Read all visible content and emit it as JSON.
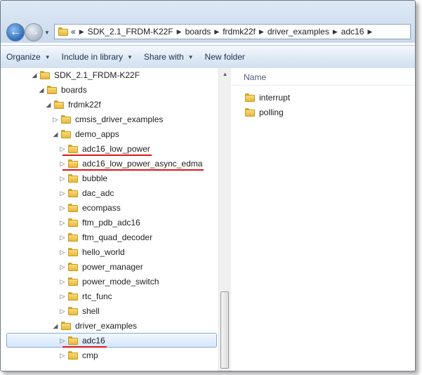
{
  "address": {
    "overflow": "«",
    "crumbs": [
      "SDK_2.1_FRDM-K22F",
      "boards",
      "frdmk22f",
      "driver_examples",
      "adc16"
    ],
    "separator": "▶"
  },
  "toolbar": {
    "organize": "Organize",
    "include_in_library": "Include in library",
    "share_with": "Share with",
    "new_folder": "New folder"
  },
  "tree": [
    {
      "label": "SDK_2.1_FRDM-K22F",
      "level": 0,
      "expander": "◢",
      "selected": false,
      "underlined": false
    },
    {
      "label": "boards",
      "level": 1,
      "expander": "◢",
      "selected": false,
      "underlined": false
    },
    {
      "label": "frdmk22f",
      "level": 2,
      "expander": "◢",
      "selected": false,
      "underlined": false
    },
    {
      "label": "cmsis_driver_examples",
      "level": 3,
      "expander": "▷",
      "selected": false,
      "underlined": false
    },
    {
      "label": "demo_apps",
      "level": 3,
      "expander": "◢",
      "selected": false,
      "underlined": false
    },
    {
      "label": "adc16_low_power",
      "level": 4,
      "expander": "▷",
      "selected": false,
      "underlined": true
    },
    {
      "label": "adc16_low_power_async_edma",
      "level": 4,
      "expander": "▷",
      "selected": false,
      "underlined": true
    },
    {
      "label": "bubble",
      "level": 4,
      "expander": "▷",
      "selected": false,
      "underlined": false
    },
    {
      "label": "dac_adc",
      "level": 4,
      "expander": "▷",
      "selected": false,
      "underlined": false
    },
    {
      "label": "ecompass",
      "level": 4,
      "expander": "▷",
      "selected": false,
      "underlined": false
    },
    {
      "label": "ftm_pdb_adc16",
      "level": 4,
      "expander": "▷",
      "selected": false,
      "underlined": false
    },
    {
      "label": "ftm_quad_decoder",
      "level": 4,
      "expander": "▷",
      "selected": false,
      "underlined": false
    },
    {
      "label": "hello_world",
      "level": 4,
      "expander": "▷",
      "selected": false,
      "underlined": false
    },
    {
      "label": "power_manager",
      "level": 4,
      "expander": "▷",
      "selected": false,
      "underlined": false
    },
    {
      "label": "power_mode_switch",
      "level": 4,
      "expander": "▷",
      "selected": false,
      "underlined": false
    },
    {
      "label": "rtc_func",
      "level": 4,
      "expander": "▷",
      "selected": false,
      "underlined": false
    },
    {
      "label": "shell",
      "level": 4,
      "expander": "▷",
      "selected": false,
      "underlined": false
    },
    {
      "label": "driver_examples",
      "level": 3,
      "expander": "◢",
      "selected": false,
      "underlined": false
    },
    {
      "label": "adc16",
      "level": 4,
      "expander": "▷",
      "selected": true,
      "underlined": true
    },
    {
      "label": "cmp",
      "level": 4,
      "expander": "▷",
      "selected": false,
      "underlined": false
    }
  ],
  "content": {
    "column_name": "Name",
    "items": [
      "interrupt",
      "polling"
    ]
  },
  "colors": {
    "annotation_underline": "#e0141e",
    "selection_border": "#84acdd",
    "folder": "#f0c850"
  }
}
